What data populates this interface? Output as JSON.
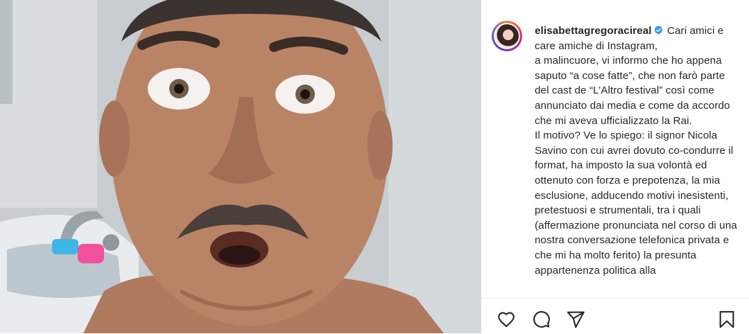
{
  "post": {
    "author": {
      "username": "elisabettagregoracireal",
      "verified": true
    },
    "caption_first": "Cari amici e care amiche di Instagram,",
    "caption_lines": [
      "a malincuore, vi informo che ho appena saputo “a cose fatte”, che non farò parte del cast de “L’Altro festival” così come annunciato dai media e come da accordo che mi aveva ufficializzato la Rai.",
      "Il motivo? Ve lo spiego: il signor Nicola Savino con cui avrei dovuto co-condurre il format, ha imposto la sua volontà ed ottenuto con forza e prepotenza, la mia esclusione, adducendo motivi inesistenti, pretestuosi e strumentali, tra i quali (affermazione pronunciata nel corso di una nostra conversazione telefonica privata e che mi ha molto ferito) la presunta appartenenza politica alla"
    ]
  },
  "actions": {
    "icons": [
      "heart-icon",
      "comment-icon",
      "share-icon",
      "bookmark-icon"
    ]
  },
  "colors": {
    "text": "#262626",
    "verified": "#3897f0",
    "divider": "#dbdbdb"
  }
}
